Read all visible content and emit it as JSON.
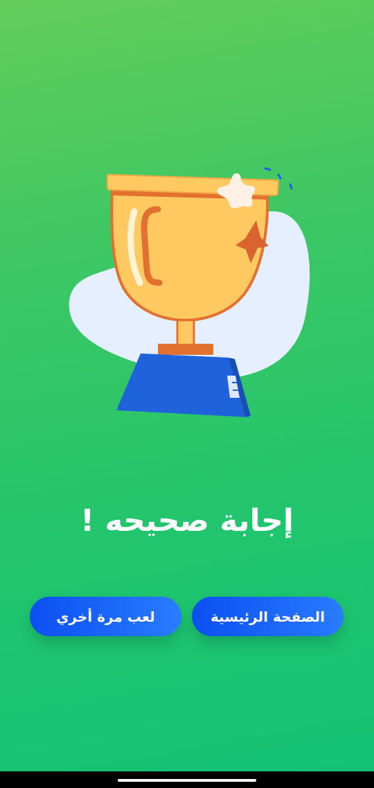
{
  "result": {
    "title": "إجابة صحيحه !"
  },
  "buttons": {
    "home_label": "الصفحة الرئيسية",
    "play_again_label": "لعب مرة أخري"
  },
  "illustration": {
    "icon": "trophy-icon"
  },
  "colors": {
    "background_top": "#63cd5a",
    "background_bottom": "#14c274",
    "button_start": "#0b4ff2",
    "button_end": "#2a7cff",
    "text": "#ffffff"
  }
}
